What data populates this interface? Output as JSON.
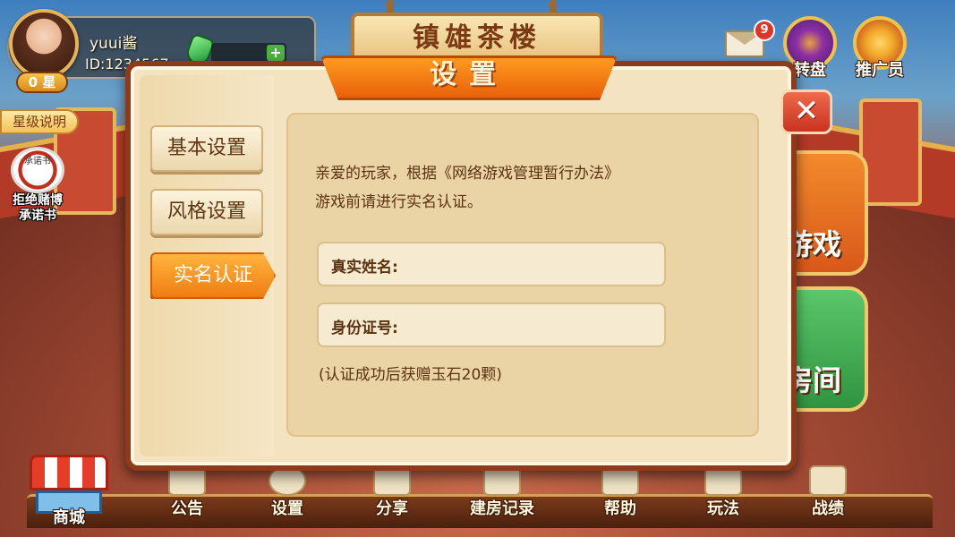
{
  "player": {
    "nickname": "yuui酱",
    "id_text": "ID:1234567",
    "stars": "0 星"
  },
  "left_menu": {
    "star_explain": "星级说明",
    "pledge_icon_text": "承诺书",
    "pledge_label_line1": "拒绝赌博",
    "pledge_label_line2": "承诺书"
  },
  "signboard": {
    "title": "镇雄茶楼"
  },
  "top_right": {
    "mail_badge": "9",
    "wheel_label": "转盘",
    "promoter_label": "推广员"
  },
  "side_tiles": {
    "tile1_text": "游戏",
    "tile2_text": "房间"
  },
  "dialog": {
    "title": "设置",
    "close_symbol": "✕",
    "menu": [
      {
        "label": "基本设置"
      },
      {
        "label": "风格设置"
      },
      {
        "label": "实名认证"
      }
    ],
    "notice_line1": "亲爱的玩家，根据《网络游戏管理暂行办法》",
    "notice_line2": "游戏前请进行实名认证。",
    "name_label": "真实姓名:",
    "name_value": "",
    "id_label": "身份证号:",
    "id_value": "",
    "reward_note": "(认证成功后获赠玉石20颗)"
  },
  "bottom_nav": [
    {
      "label": "商城"
    },
    {
      "label": "公告"
    },
    {
      "label": "设置"
    },
    {
      "label": "分享"
    },
    {
      "label": "建房记录"
    },
    {
      "label": "帮助"
    },
    {
      "label": "玩法"
    },
    {
      "label": "战绩"
    }
  ],
  "colors": {
    "accent_orange": "#f07d12",
    "dialog_bg": "#f3e3c1",
    "dialog_border": "#8e3b1b",
    "text_brown": "#5a3412"
  }
}
